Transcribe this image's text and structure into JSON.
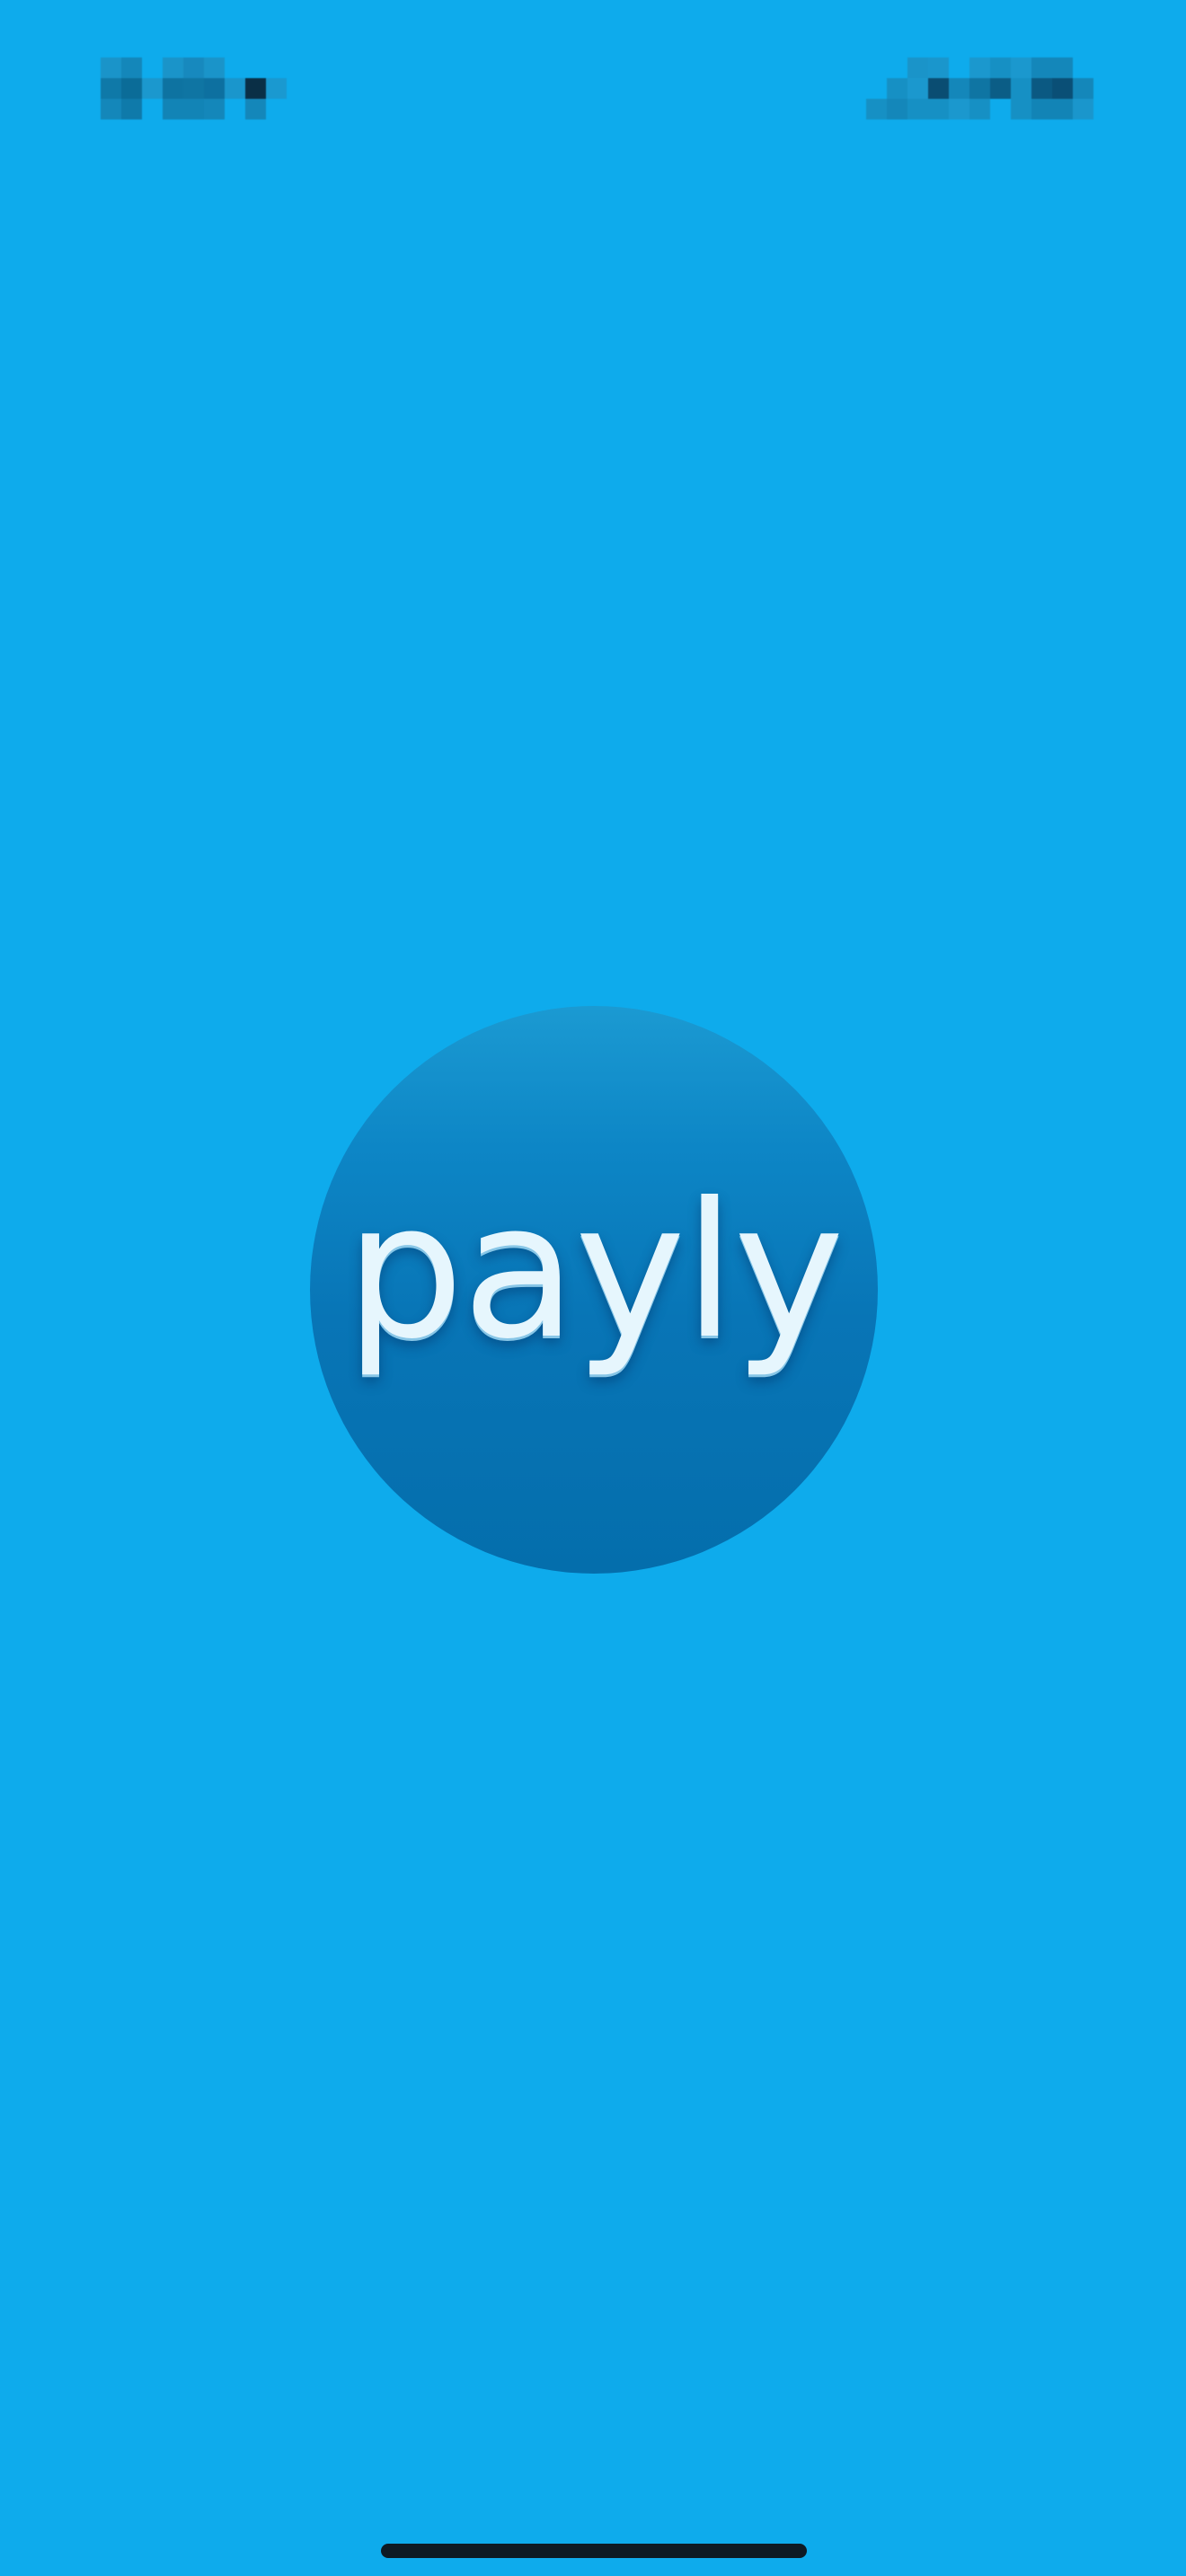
{
  "app": {
    "logo_text": "payly"
  },
  "colors": {
    "background": "#0eabec",
    "logo_circle_top": "#1b9ad2",
    "logo_circle_bottom": "#046eac",
    "logo_text": "#e6f6fd",
    "home_indicator": "#0e1a24"
  }
}
